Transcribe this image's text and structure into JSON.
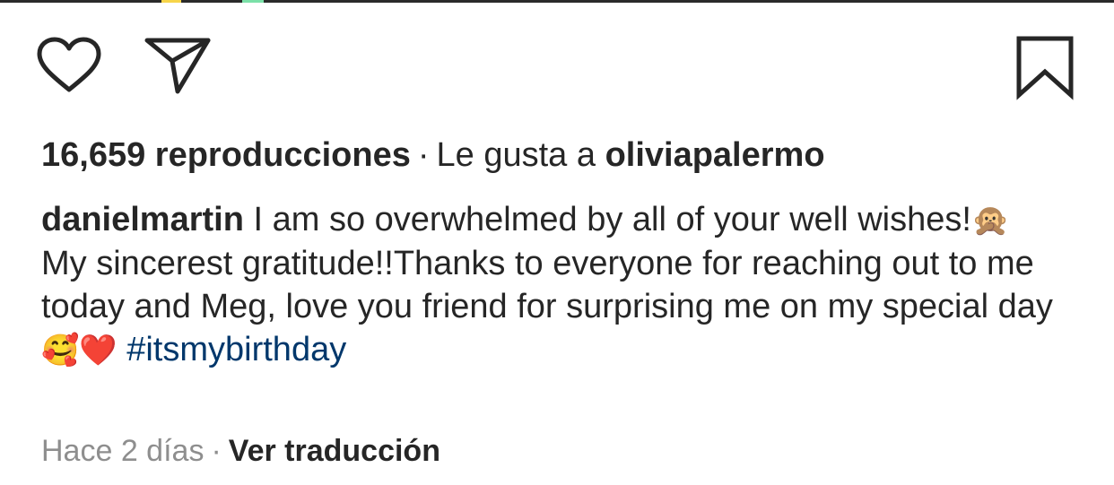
{
  "actions": {
    "like_icon": "heart-icon",
    "share_icon": "paper-plane-icon",
    "save_icon": "bookmark-icon"
  },
  "stats": {
    "views": "16,659 reproducciones",
    "separator": "·",
    "liked_by_prefix": "Le gusta a",
    "liked_by_user": "oliviapalermo"
  },
  "caption": {
    "username": "danielmartin",
    "line1_text": "I am so overwhelmed by all of your well wishes!",
    "line1_emoji": "🙊",
    "line2_text": "My sincerest gratitude!!Thanks to everyone for reaching out to me today and Meg, love you friend for surprising me on my special day",
    "line2_emojis": "🥰❤️",
    "hashtag": "#itsmybirthday"
  },
  "footer": {
    "timestamp": "Hace 2 días",
    "separator": "·",
    "translate_label": "Ver traducción"
  },
  "colors": {
    "text": "#262626",
    "muted": "#8e8e8e",
    "hashtag": "#00376b"
  }
}
